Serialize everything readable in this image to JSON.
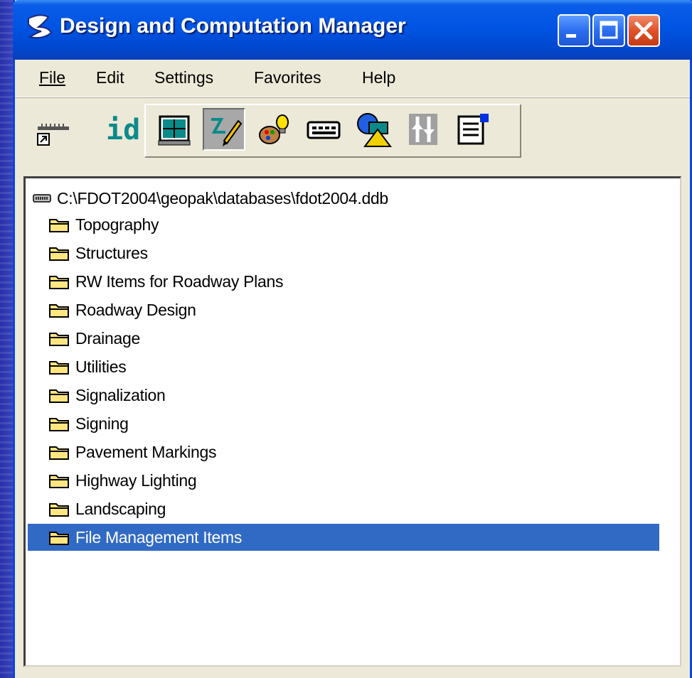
{
  "window": {
    "title": "Design and Computation Manager",
    "app_icon": "geopak-icon",
    "controls": [
      "minimize-icon",
      "maximize-icon",
      "close-icon"
    ]
  },
  "menu": {
    "file": "File",
    "edit": "Edit",
    "settings": "Settings",
    "favorites": "Favorites",
    "help": "Help"
  },
  "toolbar": {
    "id_label": "id",
    "tools": [
      "measure-icon",
      "id-icon",
      "display-icon",
      "draw-icon",
      "palette-icon",
      "keypad-icon",
      "shapes-icon",
      "adjust-icon",
      "properties-icon"
    ]
  },
  "tree": {
    "root": "C:\\FDOT2004\\geopak\\databases\\fdot2004.ddb",
    "items": [
      {
        "label": "Topography"
      },
      {
        "label": "Structures"
      },
      {
        "label": "RW Items for Roadway Plans"
      },
      {
        "label": "Roadway Design"
      },
      {
        "label": "Drainage"
      },
      {
        "label": "Utilities"
      },
      {
        "label": "Signalization"
      },
      {
        "label": "Signing"
      },
      {
        "label": "Pavement Markings"
      },
      {
        "label": "Highway Lighting"
      },
      {
        "label": "Landscaping"
      },
      {
        "label": "File Management Items",
        "selected": true
      }
    ]
  },
  "colors": {
    "titlebar": "#0054e3",
    "selection": "#316ac5",
    "folder": "#ffe680",
    "background": "#2a2fa6"
  }
}
